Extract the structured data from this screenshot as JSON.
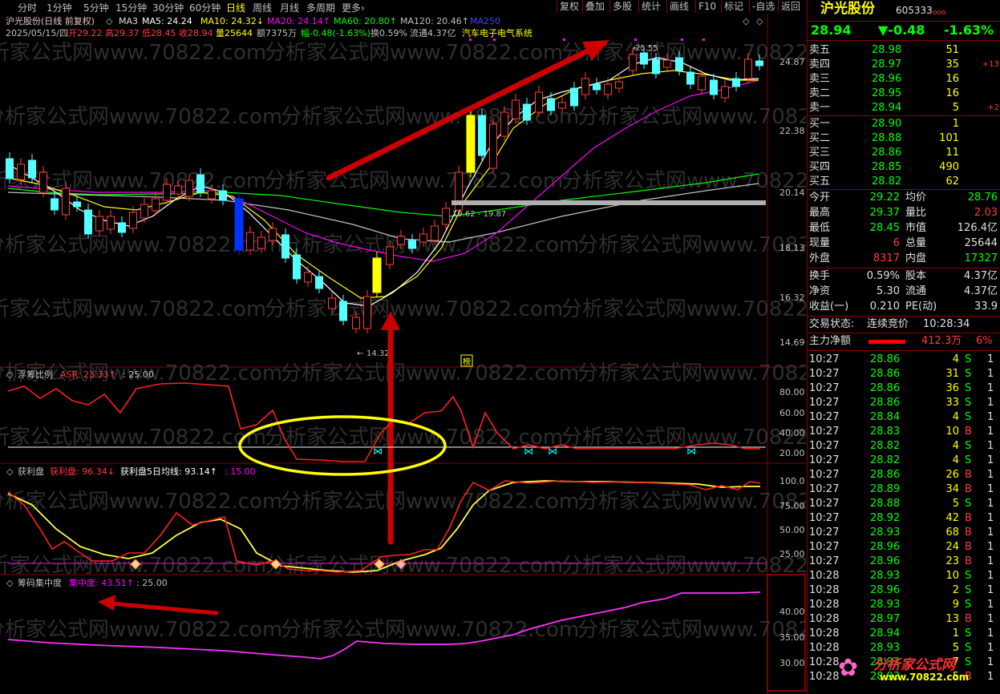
{
  "toolbar": {
    "periods": [
      "分时",
      "1分钟",
      "5分钟",
      "15分钟",
      "30分钟",
      "60分钟",
      "日线",
      "周线",
      "月线",
      "多周期",
      "更多›"
    ],
    "active_period": "日线",
    "buttons": [
      "复权",
      "叠加",
      "多股",
      "统计",
      "画线",
      "F10",
      "标记",
      "-自选",
      "返回"
    ]
  },
  "ma_line": {
    "name": "沪光股份(日线 前复权)",
    "ma3": "MA3",
    "ma5": "MA5: 24.24",
    "ma10": "MA10: 24.32↓",
    "ma20": "MA20: 24.14↑",
    "ma60": "MA60: 20.80↑",
    "ma120": "MA120: 20.46↑",
    "ma250": "MA250"
  },
  "info_line": {
    "date": "2025/05/15/四",
    "open": "开29.22",
    "high": "高29.37",
    "low": "低28.45",
    "close": "收28.94",
    "vol": "量25644",
    "amount": "额7375万",
    "change": "幅-0.48(-1.63%)",
    "turnover": "换0.59%",
    "float": "流通4.37亿",
    "sector": "汽车电子电气系统"
  },
  "price_axis": [
    "24.87",
    "22.38",
    "20.14",
    "18.13",
    "16.32",
    "14.69"
  ],
  "annotations": {
    "high": "25.55",
    "low": "14.32",
    "mid": "19.62 - 19.87",
    "bang": "榜"
  },
  "watermark": "分析家公式网www.70822.com",
  "ind1": {
    "title": "浮筹比例",
    "asr": "ASR: 23.33↑",
    "level": ": 25.00",
    "axis": [
      "80.00",
      "60.00",
      "40.00",
      "20.00"
    ]
  },
  "ind2": {
    "title": "获利盘",
    "hl": "获利盘: 96.34↓",
    "avg": "获利盘5日均线: 93.14↑",
    "level": ": 15.00",
    "axis": [
      "100.0",
      "75.00",
      "50.00",
      "25.00"
    ]
  },
  "ind3": {
    "title": "筹码集中度",
    "jz": "集中度: 43.51↑",
    "level": ": 25.00",
    "axis": [
      "40.00",
      "35.00",
      "30.00"
    ]
  },
  "quote": {
    "name": "沪光股份",
    "code": "605333",
    "code_suffix": "ooo",
    "price": "28.94",
    "change": "▼-0.48",
    "pct": "-1.63%",
    "asks": [
      {
        "label": "卖五",
        "price": "28.98",
        "vol": "51",
        "delta": ""
      },
      {
        "label": "卖四",
        "price": "28.97",
        "vol": "35",
        "delta": "+13"
      },
      {
        "label": "卖三",
        "price": "28.96",
        "vol": "16",
        "delta": ""
      },
      {
        "label": "卖二",
        "price": "28.95",
        "vol": "16",
        "delta": ""
      },
      {
        "label": "卖一",
        "price": "28.94",
        "vol": "5",
        "delta": "+2"
      }
    ],
    "bids": [
      {
        "label": "买一",
        "price": "28.90",
        "vol": "1"
      },
      {
        "label": "买二",
        "price": "28.88",
        "vol": "101"
      },
      {
        "label": "买三",
        "price": "28.86",
        "vol": "11"
      },
      {
        "label": "买四",
        "price": "28.85",
        "vol": "490"
      },
      {
        "label": "买五",
        "price": "28.82",
        "vol": "62"
      }
    ],
    "stats": [
      {
        "l1": "今开",
        "v1": "29.22",
        "l2": "均价",
        "v2": "28.76"
      },
      {
        "l1": "最高",
        "v1": "29.37",
        "l2": "量比",
        "v2": "2.03"
      },
      {
        "l1": "最低",
        "v1": "28.45",
        "l2": "市值",
        "v2": "126.4亿"
      },
      {
        "l1": "现量",
        "v1": "6",
        "l2": "总量",
        "v2": "25644"
      },
      {
        "l1": "外盘",
        "v1": "8317",
        "l2": "内盘",
        "v2": "17327"
      }
    ],
    "stats2": [
      {
        "l1": "换手",
        "v1": "0.59%",
        "l2": "股本",
        "v2": "4.37亿"
      },
      {
        "l1": "净资",
        "v1": "5.30",
        "l2": "流通",
        "v2": "4.37亿"
      },
      {
        "l1": "收益(一)",
        "v1": "0.210",
        "l2": "PE(动)",
        "v2": "33.9"
      }
    ],
    "status_label": "交易状态:",
    "status_value": "连续竞价",
    "status_time": "10:28:34",
    "netflow_label": "主力净额",
    "netflow_value": "412.3万",
    "netflow_pct": "6%"
  },
  "ticks": [
    {
      "t": "10:27",
      "p": "28.86",
      "v": "4",
      "d": "S"
    },
    {
      "t": "10:27",
      "p": "28.86",
      "v": "31",
      "d": "S"
    },
    {
      "t": "10:27",
      "p": "28.86",
      "v": "36",
      "d": "S"
    },
    {
      "t": "10:27",
      "p": "28.86",
      "v": "33",
      "d": "S"
    },
    {
      "t": "10:27",
      "p": "28.84",
      "v": "4",
      "d": "S"
    },
    {
      "t": "10:27",
      "p": "28.83",
      "v": "10",
      "d": "B"
    },
    {
      "t": "10:27",
      "p": "28.82",
      "v": "4",
      "d": "S"
    },
    {
      "t": "10:27",
      "p": "28.82",
      "v": "4",
      "d": "S"
    },
    {
      "t": "10:27",
      "p": "28.86",
      "v": "26",
      "d": "B"
    },
    {
      "t": "10:27",
      "p": "28.89",
      "v": "34",
      "d": "B"
    },
    {
      "t": "10:27",
      "p": "28.88",
      "v": "5",
      "d": "S"
    },
    {
      "t": "10:27",
      "p": "28.92",
      "v": "42",
      "d": "B"
    },
    {
      "t": "10:27",
      "p": "28.93",
      "v": "68",
      "d": "B"
    },
    {
      "t": "10:27",
      "p": "28.96",
      "v": "24",
      "d": "B"
    },
    {
      "t": "10:27",
      "p": "28.96",
      "v": "23",
      "d": "B"
    },
    {
      "t": "10:28",
      "p": "28.93",
      "v": "10",
      "d": "S"
    },
    {
      "t": "10:28",
      "p": "28.96",
      "v": "2",
      "d": "S"
    },
    {
      "t": "10:28",
      "p": "28.93",
      "v": "9",
      "d": "S"
    },
    {
      "t": "10:28",
      "p": "28.97",
      "v": "13",
      "d": "B"
    },
    {
      "t": "10:28",
      "p": "28.94",
      "v": "1",
      "d": "S"
    },
    {
      "t": "10:28",
      "p": "28.93",
      "v": "5",
      "d": "S"
    },
    {
      "t": "10:28",
      "p": "28.92",
      "v": "7",
      "d": "S"
    },
    {
      "t": "10:28",
      "p": "28.93",
      "v": "5",
      "d": "B"
    }
  ],
  "logo": {
    "site": "分析家公式网",
    "url": "www.70822.com"
  },
  "colors": {
    "up": "#ff3b3b",
    "down": "#54ffff",
    "ma5": "#ffffff",
    "ma10": "#ffff00",
    "ma20": "#ff00ff",
    "ma60": "#00ff00",
    "border": "#8b0000",
    "yellow": "#ffff00",
    "magenta": "#ff00ff"
  }
}
